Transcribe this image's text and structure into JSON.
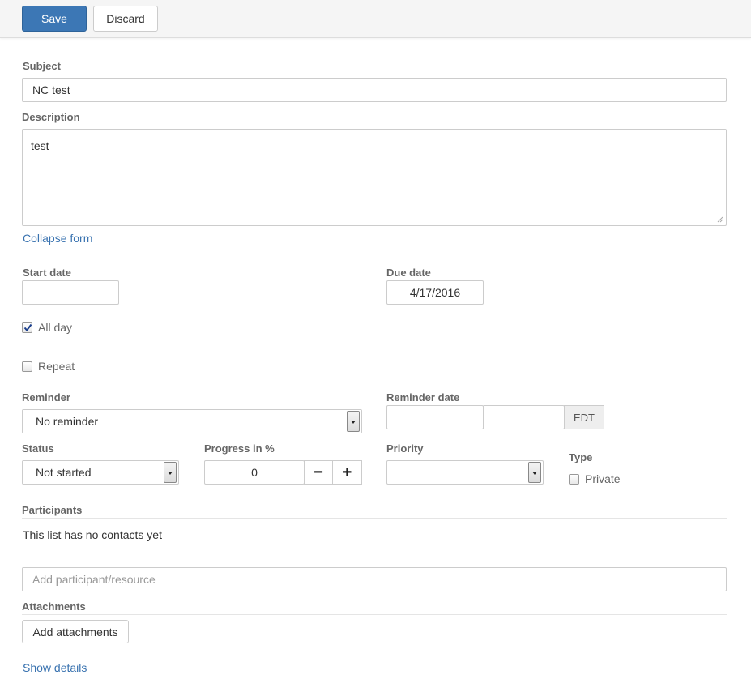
{
  "toolbar": {
    "save_label": "Save",
    "discard_label": "Discard"
  },
  "subject": {
    "label": "Subject",
    "value": "NC test"
  },
  "description": {
    "label": "Description",
    "value": "test"
  },
  "collapse_form_label": "Collapse form",
  "start_date": {
    "label": "Start date",
    "value": ""
  },
  "due_date": {
    "label": "Due date",
    "value": "4/17/2016"
  },
  "all_day": {
    "label": "All day",
    "checked": true
  },
  "repeat": {
    "label": "Repeat",
    "checked": false
  },
  "reminder": {
    "label": "Reminder",
    "selected": "No reminder"
  },
  "reminder_date": {
    "label": "Reminder date",
    "timezone": "EDT"
  },
  "status": {
    "label": "Status",
    "selected": "Not started"
  },
  "progress": {
    "label": "Progress in %",
    "value": "0",
    "minus": "−",
    "plus": "+"
  },
  "priority": {
    "label": "Priority",
    "selected": ""
  },
  "type": {
    "label": "Type",
    "private_label": "Private",
    "private_checked": false
  },
  "participants": {
    "label": "Participants",
    "empty_text": "This list has no contacts yet",
    "add_placeholder": "Add participant/resource"
  },
  "attachments": {
    "label": "Attachments",
    "add_button": "Add attachments"
  },
  "show_details_label": "Show details"
}
